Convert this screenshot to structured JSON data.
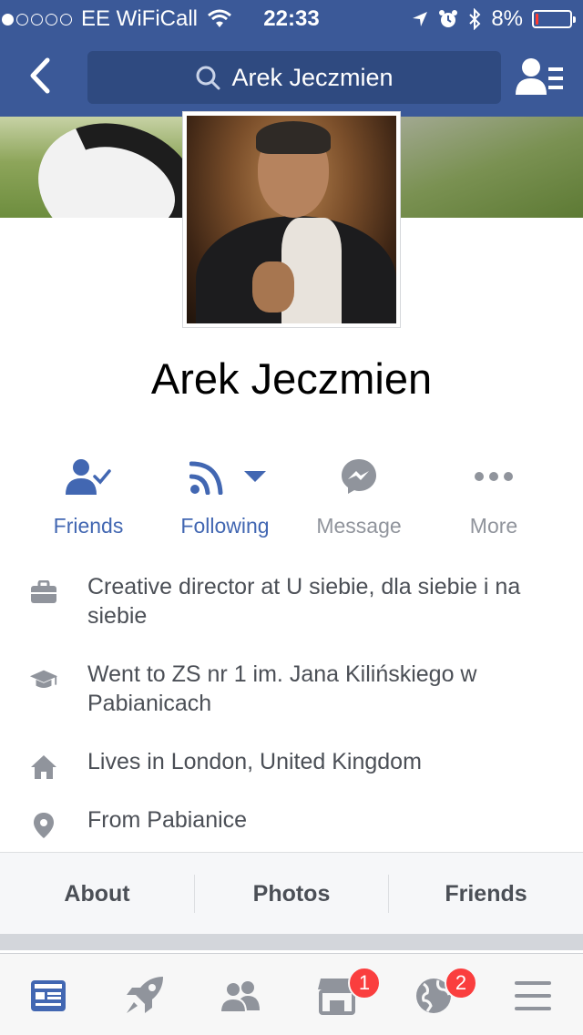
{
  "status_bar": {
    "carrier": "EE WiFiCall",
    "time": "22:33",
    "battery": "8%",
    "battery_level": 0.08,
    "signal_bars_filled": 1,
    "signal_bars_total": 5
  },
  "nav": {
    "search_text": "Arek Jeczmien",
    "icons": {
      "back": "back-chevron-icon",
      "search": "search-icon",
      "friend_requests": "friend-requests-icon"
    }
  },
  "profile": {
    "name": "Arek Jeczmien"
  },
  "actions": [
    {
      "label": "Friends",
      "icon": "friends-check-icon",
      "color": "#4267b2"
    },
    {
      "label": "Following",
      "icon": "rss-follow-icon",
      "color": "#4267b2"
    },
    {
      "label": "Message",
      "icon": "messenger-icon",
      "color": "#90949c"
    },
    {
      "label": "More",
      "icon": "more-dots-icon",
      "color": "#90949c"
    }
  ],
  "intro": [
    {
      "icon": "briefcase-icon",
      "text": "Creative director at U siebie, dla siebie i na siebie"
    },
    {
      "icon": "graduation-cap-icon",
      "text": "Went to ZS nr 1 im. Jana Kilińskiego w Pabianicach"
    },
    {
      "icon": "home-icon",
      "text": "Lives in London, United Kingdom"
    },
    {
      "icon": "location-pin-icon",
      "text": "From Pabianice"
    }
  ],
  "tabs": [
    {
      "label": "About"
    },
    {
      "label": "Photos"
    },
    {
      "label": "Friends"
    }
  ],
  "tab_bar": {
    "items": [
      {
        "icon": "news-feed-icon",
        "active": true
      },
      {
        "icon": "rocket-icon"
      },
      {
        "icon": "friends-icon"
      },
      {
        "icon": "marketplace-icon",
        "badge": "1"
      },
      {
        "icon": "globe-notifications-icon",
        "badge": "2"
      },
      {
        "icon": "menu-icon"
      }
    ]
  },
  "colors": {
    "brand": "#3b5998",
    "action_blue": "#4267b2",
    "badge_red": "#fa3e3e"
  }
}
